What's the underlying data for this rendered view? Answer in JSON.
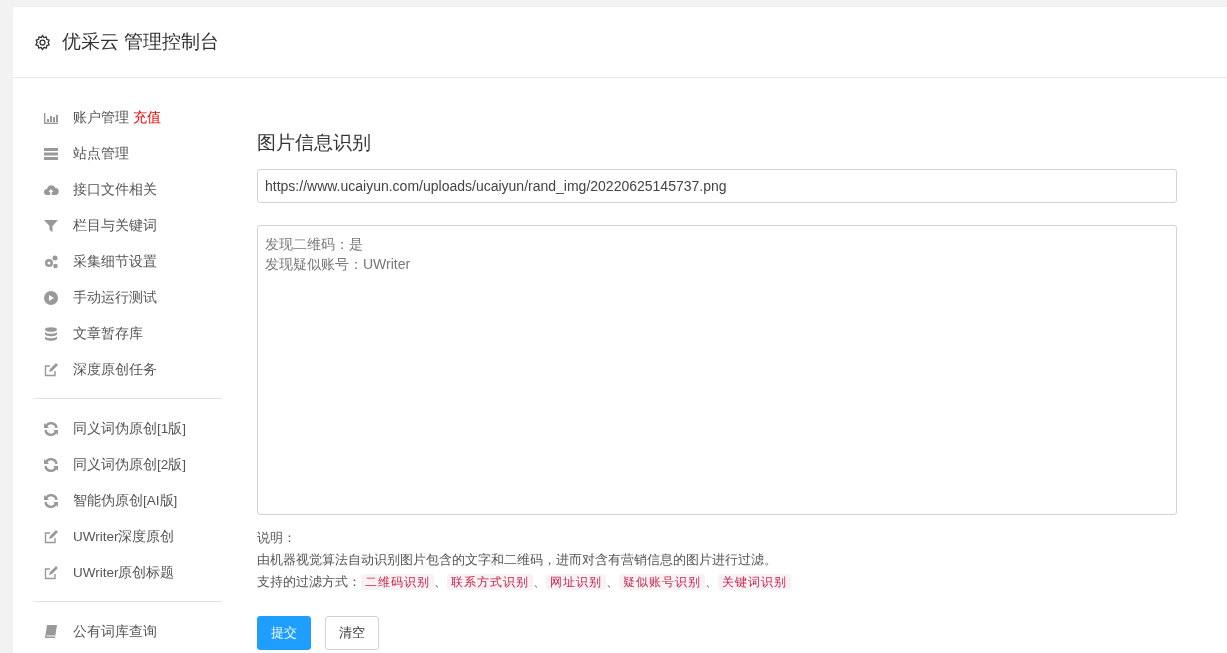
{
  "header": {
    "title": "优采云 管理控制台"
  },
  "sidebar": {
    "groups": [
      {
        "items": [
          {
            "label": "账户管理",
            "tag": "充值"
          },
          {
            "label": "站点管理"
          },
          {
            "label": "接口文件相关"
          },
          {
            "label": "栏目与关键词"
          },
          {
            "label": "采集细节设置"
          },
          {
            "label": "手动运行测试"
          },
          {
            "label": "文章暂存库"
          },
          {
            "label": "深度原创任务"
          }
        ]
      },
      {
        "items": [
          {
            "label": "同义词伪原创[1版]"
          },
          {
            "label": "同义词伪原创[2版]"
          },
          {
            "label": "智能伪原创[AI版]"
          },
          {
            "label": "UWriter深度原创"
          },
          {
            "label": "UWriter原创标题"
          }
        ]
      },
      {
        "items": [
          {
            "label": "公有词库查询"
          }
        ]
      }
    ]
  },
  "main": {
    "heading": "图片信息识别",
    "url_field": {
      "value": "https://www.ucaiyun.com/uploads/ucaiyun/rand_img/20220625145737.png"
    },
    "result_field": {
      "lines": [
        "发现二维码：是",
        "发现疑似账号：UWriter"
      ]
    },
    "notes_title": "说明：",
    "description": "由机器视觉算法自动识别图片包含的文字和二维码，进而对含有营销信息的图片进行过滤。",
    "filters_label": "支持的过滤方式：",
    "filters": [
      "二维码识别",
      "联系方式识别",
      "网址识别",
      "疑似账号识别",
      "关键词识别"
    ],
    "separator": "、",
    "buttons": [
      {
        "label": "提交",
        "kind": "primary"
      },
      {
        "label": "清空",
        "kind": "default"
      }
    ]
  }
}
